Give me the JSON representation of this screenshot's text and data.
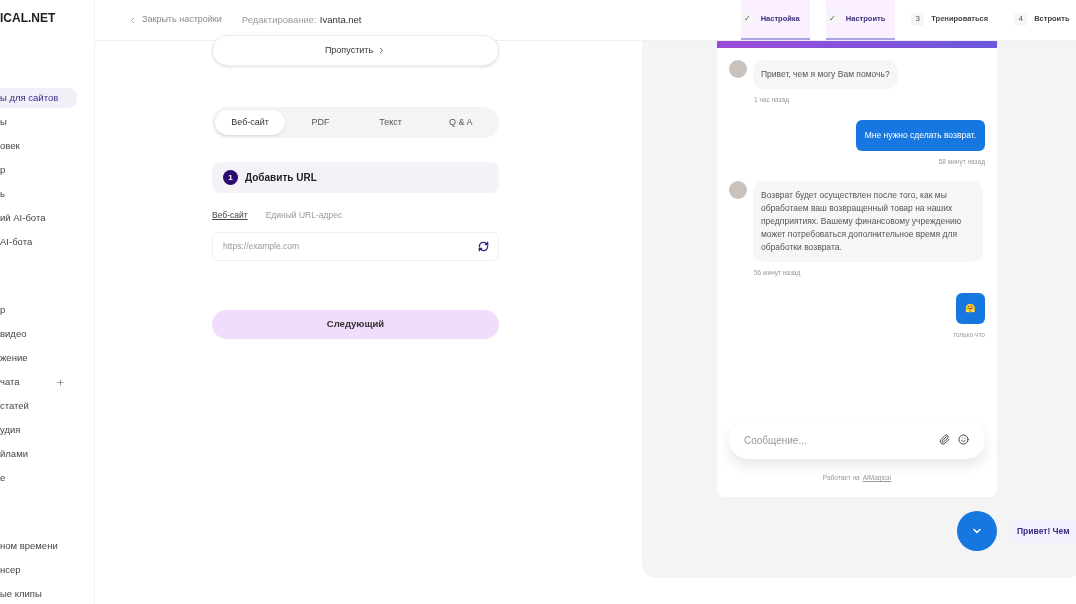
{
  "sidebar": {
    "logo": "ICAL.NET",
    "groups": [
      {
        "items": [
          {
            "label": "ы для сайтов",
            "selected": true,
            "add": false
          },
          {
            "label": "ы",
            "selected": false,
            "add": false
          },
          {
            "label": "овек",
            "selected": false,
            "add": false
          },
          {
            "label": "р",
            "selected": false,
            "add": false
          },
          {
            "label": "ь",
            "selected": false,
            "add": false
          },
          {
            "label": "ий AI-бота",
            "selected": false,
            "add": false
          },
          {
            "label": "AI-бота",
            "selected": false,
            "add": false
          }
        ]
      },
      {
        "items": [
          {
            "label": "р",
            "selected": false,
            "add": false
          },
          {
            "label": "видео",
            "selected": false,
            "add": false
          },
          {
            "label": "жение",
            "selected": false,
            "add": false
          },
          {
            "label": "чата",
            "selected": false,
            "add": true
          },
          {
            "label": "статей",
            "selected": false,
            "add": false
          },
          {
            "label": "удия",
            "selected": false,
            "add": false
          },
          {
            "label": "йлами",
            "selected": false,
            "add": false
          },
          {
            "label": "е",
            "selected": false,
            "add": false
          }
        ]
      },
      {
        "items": [
          {
            "label": "ном времени",
            "selected": false,
            "add": false
          },
          {
            "label": "нсер",
            "selected": false,
            "add": false
          },
          {
            "label": "ые клипы",
            "selected": false,
            "add": false
          }
        ]
      }
    ]
  },
  "topbar": {
    "back": "Закрыть настройки",
    "editing_label": "Редактирование:",
    "editing_value": "Ivanta.net",
    "steps": [
      {
        "marker": "✓",
        "label": "Настройка",
        "done": true
      },
      {
        "marker": "✓",
        "label": "Настроить",
        "done": true
      },
      {
        "marker": "3",
        "label": "Тренироваться",
        "done": false
      },
      {
        "marker": "4",
        "label": "Встроить",
        "done": false
      }
    ]
  },
  "skip_button": "Пропустить",
  "source_tabs": [
    {
      "label": "Веб-сайт",
      "selected": true
    },
    {
      "label": "PDF",
      "selected": false
    },
    {
      "label": "Текст",
      "selected": false
    },
    {
      "label": "Q & A",
      "selected": false
    }
  ],
  "step_header": {
    "number": "1",
    "title": "Добавить URL"
  },
  "url_tabs": [
    {
      "label": "Веб-сайт",
      "selected": true
    },
    {
      "label": "Единый URL-адрес",
      "selected": false
    }
  ],
  "url_field": {
    "placeholder": "https://example.com"
  },
  "next_button": "Следующий",
  "chat": {
    "messages": [
      {
        "kind": "bot",
        "text": "Привет, чем я могу Вам помочь?",
        "time": "1 час назад"
      },
      {
        "kind": "user",
        "text": "Мне нужно сделать возврат.",
        "time": "58 минут назад"
      },
      {
        "kind": "bot",
        "text": "Возврат будет осуществлен после того, как мы обработаем ваш возвращенный товар на наших предприятиях. Вашему финансовому учреждению может потребоваться дополнительное время для обработки возврата.",
        "time": "56 минут назад"
      },
      {
        "kind": "user",
        "text": "🤗",
        "time": "только что"
      }
    ],
    "input": {
      "placeholder": "Сообщение..."
    },
    "powered_by": "Работает на",
    "powered_link": "AIMagical",
    "greeting": "Привет! Чем"
  }
}
